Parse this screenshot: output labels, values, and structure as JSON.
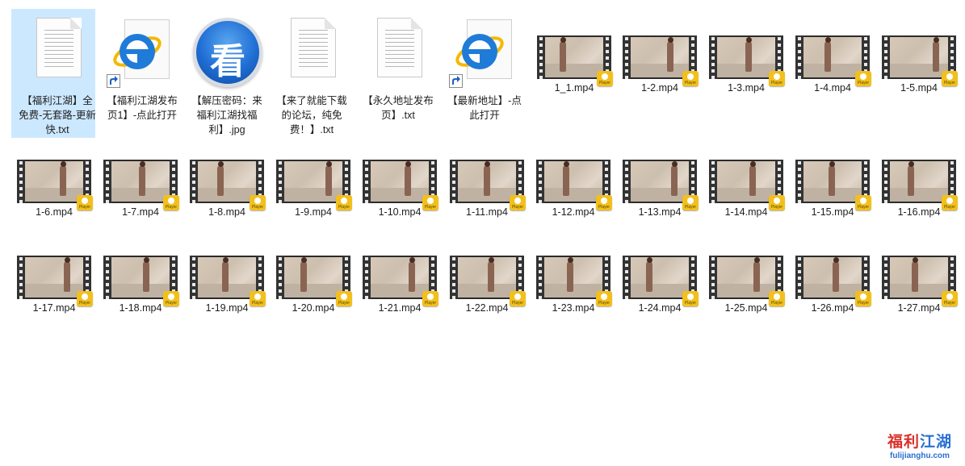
{
  "files_row1": [
    {
      "name": "【福利江湖】全免费-无套路-更新快.txt",
      "icon": "text-document-icon",
      "selected": true
    },
    {
      "name": "【福利江湖发布页1】-点此打开",
      "icon": "ie-shortcut-icon"
    },
    {
      "name": "【解压密码：来福利江湖找福利】.jpg",
      "icon": "kan-image-icon"
    },
    {
      "name": "【来了就能下载的论坛，纯免费！】.txt",
      "icon": "text-document-icon"
    },
    {
      "name": "【永久地址发布页】.txt",
      "icon": "text-document-icon"
    },
    {
      "name": "【最新地址】-点此打开",
      "icon": "ie-shortcut-icon"
    }
  ],
  "videos": [
    "1_1.mp4",
    "1-2.mp4",
    "1-3.mp4",
    "1-4.mp4",
    "1-5.mp4",
    "1-6.mp4",
    "1-7.mp4",
    "1-8.mp4",
    "1-9.mp4",
    "1-10.mp4",
    "1-11.mp4",
    "1-12.mp4",
    "1-13.mp4",
    "1-14.mp4",
    "1-15.mp4",
    "1-16.mp4",
    "1-17.mp4",
    "1-18.mp4",
    "1-19.mp4",
    "1-20.mp4",
    "1-21.mp4",
    "1-22.mp4",
    "1-23.mp4",
    "1-24.mp4",
    "1-25.mp4",
    "1-26.mp4",
    "1-27.mp4"
  ],
  "kan_glyph": "看",
  "player_badge": "Player",
  "watermark": {
    "title_a": "福利",
    "title_b": "江湖",
    "url": "fulijianghu.com"
  },
  "colors": {
    "selection": "#cce8ff",
    "ie_blue": "#1f7bd8",
    "badge_yellow": "#f2c01d",
    "watermark_red": "#d9302a",
    "watermark_blue": "#2a6fd1"
  }
}
